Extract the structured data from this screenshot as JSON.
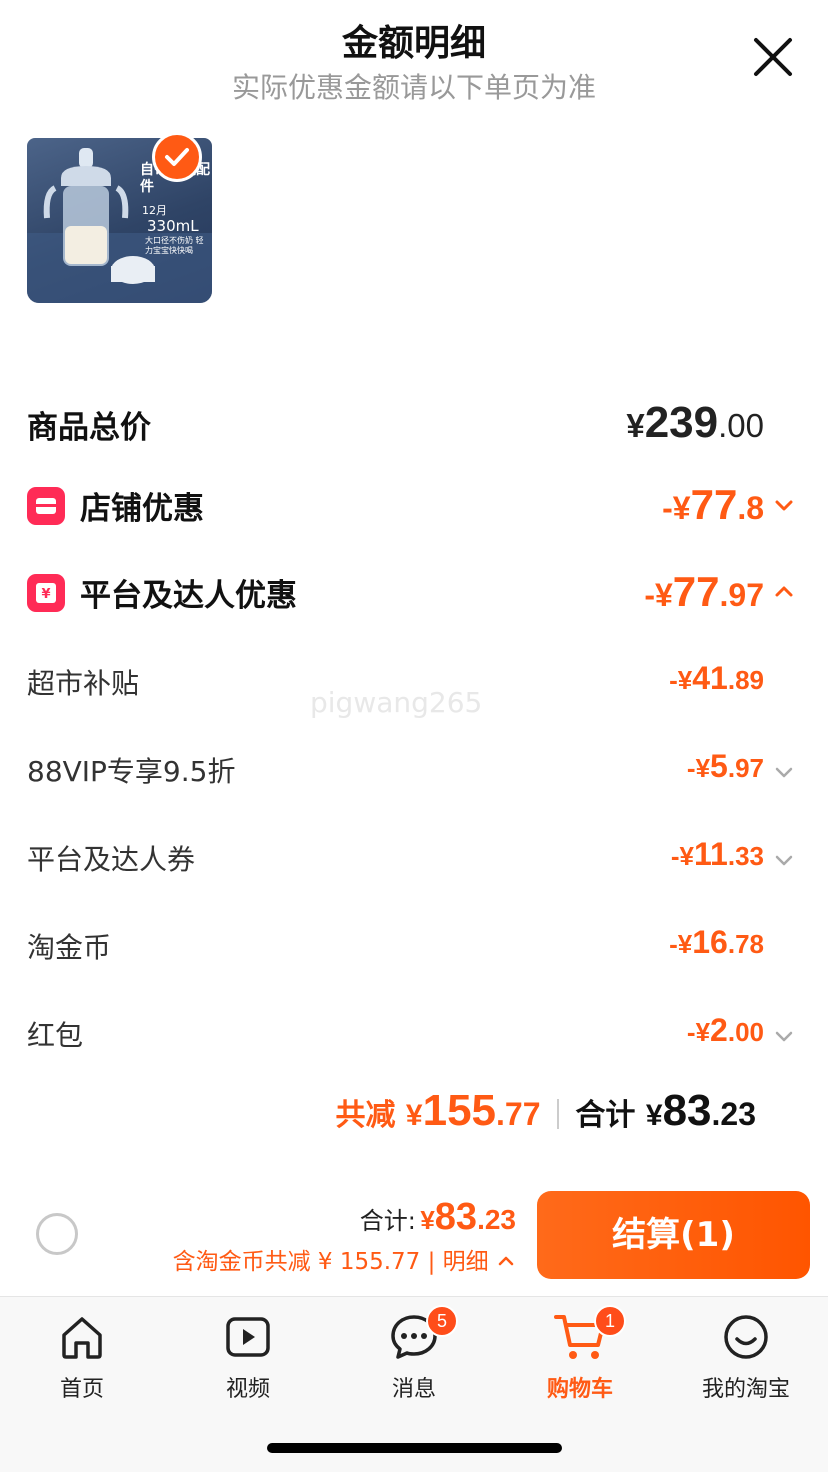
{
  "header": {
    "title": "金额明细",
    "subtitle": "实际优惠金额请以下单页为准"
  },
  "product": {
    "image_text_line1": "自带原装配件",
    "image_text_volume": "330mL",
    "image_text_age": "12月",
    "image_text_note": "大口径不伤奶 轻力宝宝快快喝"
  },
  "price_rows": {
    "goods_total": {
      "label": "商品总价",
      "currency": "¥",
      "int": "239",
      "dec": ".00"
    },
    "shop_discount": {
      "label": "店铺优惠",
      "prefix": "-¥",
      "int": "77",
      "dec": ".8"
    },
    "platform_discount": {
      "label": "平台及达人优惠",
      "prefix": "-¥",
      "int": "77",
      "dec": ".97"
    },
    "supermarket_subsidy": {
      "label": "超市补贴",
      "prefix": "-¥",
      "int": "41",
      "dec": ".89"
    },
    "vip_discount": {
      "label": "88VIP专享9.5折",
      "prefix": "-¥",
      "int": "5",
      "dec": ".97"
    },
    "coupon": {
      "label": "平台及达人券",
      "prefix": "-¥",
      "int": "11",
      "dec": ".33"
    },
    "taojinbi": {
      "label": "淘金币",
      "prefix": "-¥",
      "int": "16",
      "dec": ".78"
    },
    "red_packet": {
      "label": "红包",
      "prefix": "-¥",
      "int": "2",
      "dec": ".00"
    }
  },
  "summary": {
    "reduce_label": "共减",
    "reduce_currency": "¥",
    "reduce_int": "155",
    "reduce_dec": ".77",
    "total_label": "合计",
    "total_currency": "¥",
    "total_int": "83",
    "total_dec": ".23"
  },
  "bottom_bar": {
    "total_label": "合计:",
    "total_currency": "¥",
    "total_int": "83",
    "total_dec": ".23",
    "detail_text": "含淘金币共减 ¥ 155.77 | 明细",
    "checkout_label": "结算(1)"
  },
  "tabs": [
    {
      "label": "首页",
      "icon": "home-icon"
    },
    {
      "label": "视频",
      "icon": "video-icon"
    },
    {
      "label": "消息",
      "icon": "message-icon",
      "badge": "5"
    },
    {
      "label": "购物车",
      "icon": "cart-icon",
      "badge": "1",
      "active": true
    },
    {
      "label": "我的淘宝",
      "icon": "profile-icon"
    }
  ],
  "watermark": "pigwang265",
  "colors": {
    "accent": "#ff5a14",
    "icon_red": "#ff2b56",
    "text_dark": "#111111",
    "text_gray": "#999999"
  }
}
